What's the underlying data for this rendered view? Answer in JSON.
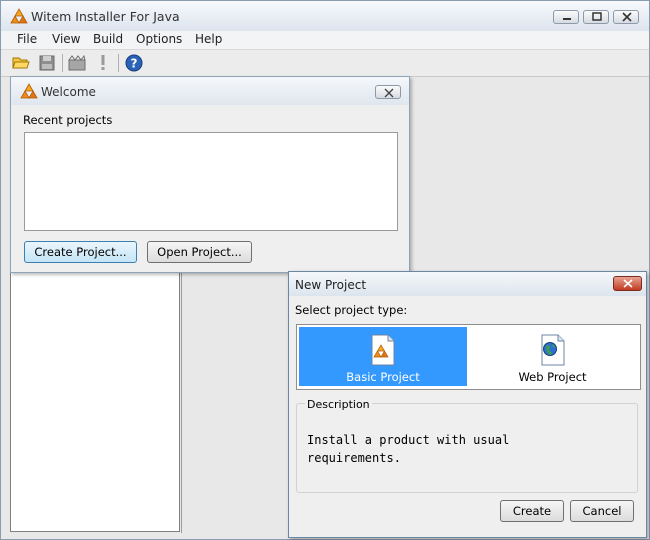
{
  "window": {
    "title": "Witem Installer For Java"
  },
  "menubar": {
    "items": [
      "File",
      "View",
      "Build",
      "Options",
      "Help"
    ]
  },
  "toolbar": {
    "buttons": [
      "open-folder-icon",
      "save-icon",
      "build-icon",
      "run-icon",
      "help-icon"
    ]
  },
  "welcome": {
    "title": "Welcome",
    "recent_label": "Recent projects",
    "recent_projects": [],
    "create_button": "Create Project...",
    "open_button": "Open Project..."
  },
  "new_project": {
    "title": "New Project",
    "select_label": "Select project type:",
    "types": [
      {
        "label": "Basic Project",
        "icon": "basic-project-icon",
        "selected": true
      },
      {
        "label": "Web Project",
        "icon": "web-project-icon",
        "selected": false
      }
    ],
    "description_label": "Description",
    "description_text": "Install a product with usual\nrequirements.",
    "create_button": "Create",
    "cancel_button": "Cancel"
  },
  "colors": {
    "selection": "#3399ff",
    "close_button": "#c23b22"
  }
}
